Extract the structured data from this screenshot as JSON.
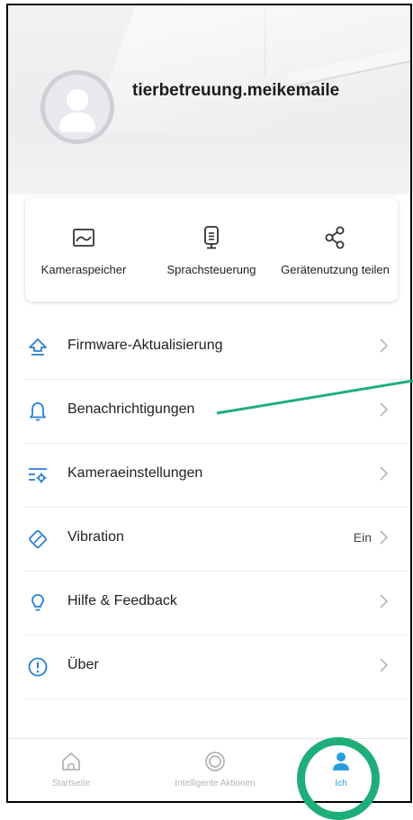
{
  "profile": {
    "username": "tierbetreuung.meikemaile"
  },
  "shortcuts": [
    {
      "label": "Kameraspeicher",
      "icon": "image-frame-icon"
    },
    {
      "label": "Sprachsteuerung",
      "icon": "microphone-device-icon"
    },
    {
      "label": "Gerätenutzung teilen",
      "icon": "share-icon"
    }
  ],
  "menu": [
    {
      "label": "Firmware-Aktualisierung",
      "icon": "upgrade-arrow-icon",
      "value": ""
    },
    {
      "label": "Benachrichtigungen",
      "icon": "bell-icon",
      "value": ""
    },
    {
      "label": "Kameraeinstellungen",
      "icon": "camera-settings-icon",
      "value": ""
    },
    {
      "label": "Vibration",
      "icon": "vibration-icon",
      "value": "Ein"
    },
    {
      "label": "Hilfe & Feedback",
      "icon": "lightbulb-icon",
      "value": ""
    },
    {
      "label": "Über",
      "icon": "info-icon",
      "value": ""
    }
  ],
  "tabs": [
    {
      "label": "Startseite",
      "icon": "home-icon"
    },
    {
      "label": "Intelligente Aktionen",
      "icon": "smart-ring-icon"
    },
    {
      "label": "Ich",
      "icon": "person-icon",
      "active": true
    }
  ],
  "colors": {
    "accent": "#2a9dde",
    "annotation": "#1fae7a"
  }
}
